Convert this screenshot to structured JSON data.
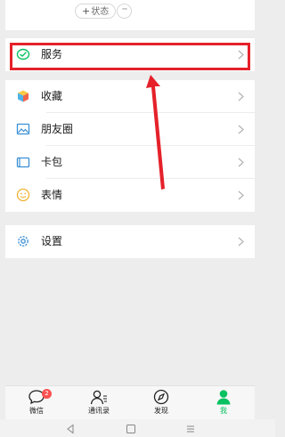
{
  "profile": {
    "status_label": "状态",
    "more_label": "···"
  },
  "menu": {
    "services": "服务",
    "favorites": "收藏",
    "moments": "朋友圈",
    "cards": "卡包",
    "stickers": "表情",
    "settings": "设置"
  },
  "tabbar": {
    "chats": "微信",
    "chats_badge": "2",
    "contacts": "通讯录",
    "discover": "发现",
    "me": "我"
  },
  "colors": {
    "accent": "#07c160",
    "highlight": "#e5212a",
    "badge": "#fa5151"
  },
  "icons": {
    "services": "services-icon",
    "favorites": "favorites-cube-icon",
    "moments": "moments-image-icon",
    "cards": "card-wallet-icon",
    "stickers": "smiley-icon",
    "settings": "gear-icon"
  }
}
